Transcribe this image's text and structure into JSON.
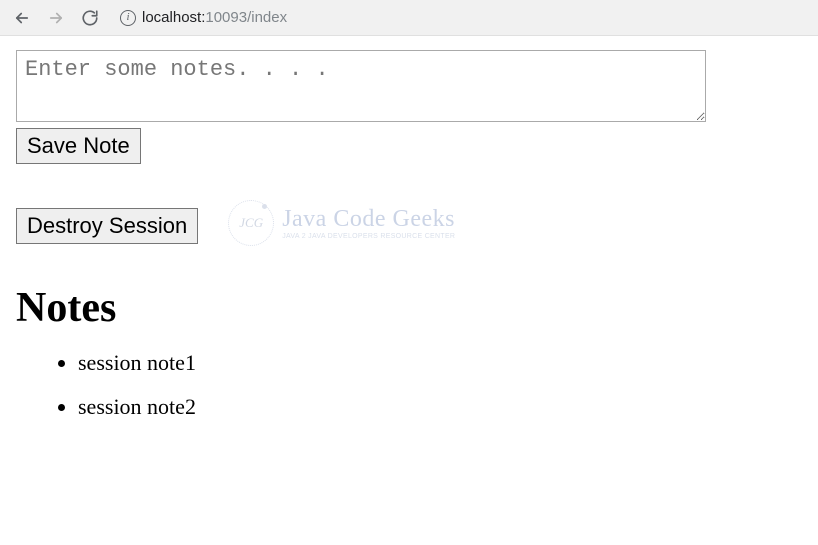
{
  "browser": {
    "url_host": "localhost:",
    "url_port_path": "10093/index"
  },
  "form": {
    "textarea_value": "",
    "textarea_placeholder": "Enter some notes. . . .",
    "save_button_label": "Save Note",
    "destroy_button_label": "Destroy Session"
  },
  "watermark": {
    "badge_text": "JCG",
    "main_text": "Java Code Geeks",
    "sub_text": "Java 2 Java Developers Resource Center"
  },
  "notes": {
    "heading": "Notes",
    "items": [
      "session note1",
      "session note2"
    ]
  }
}
